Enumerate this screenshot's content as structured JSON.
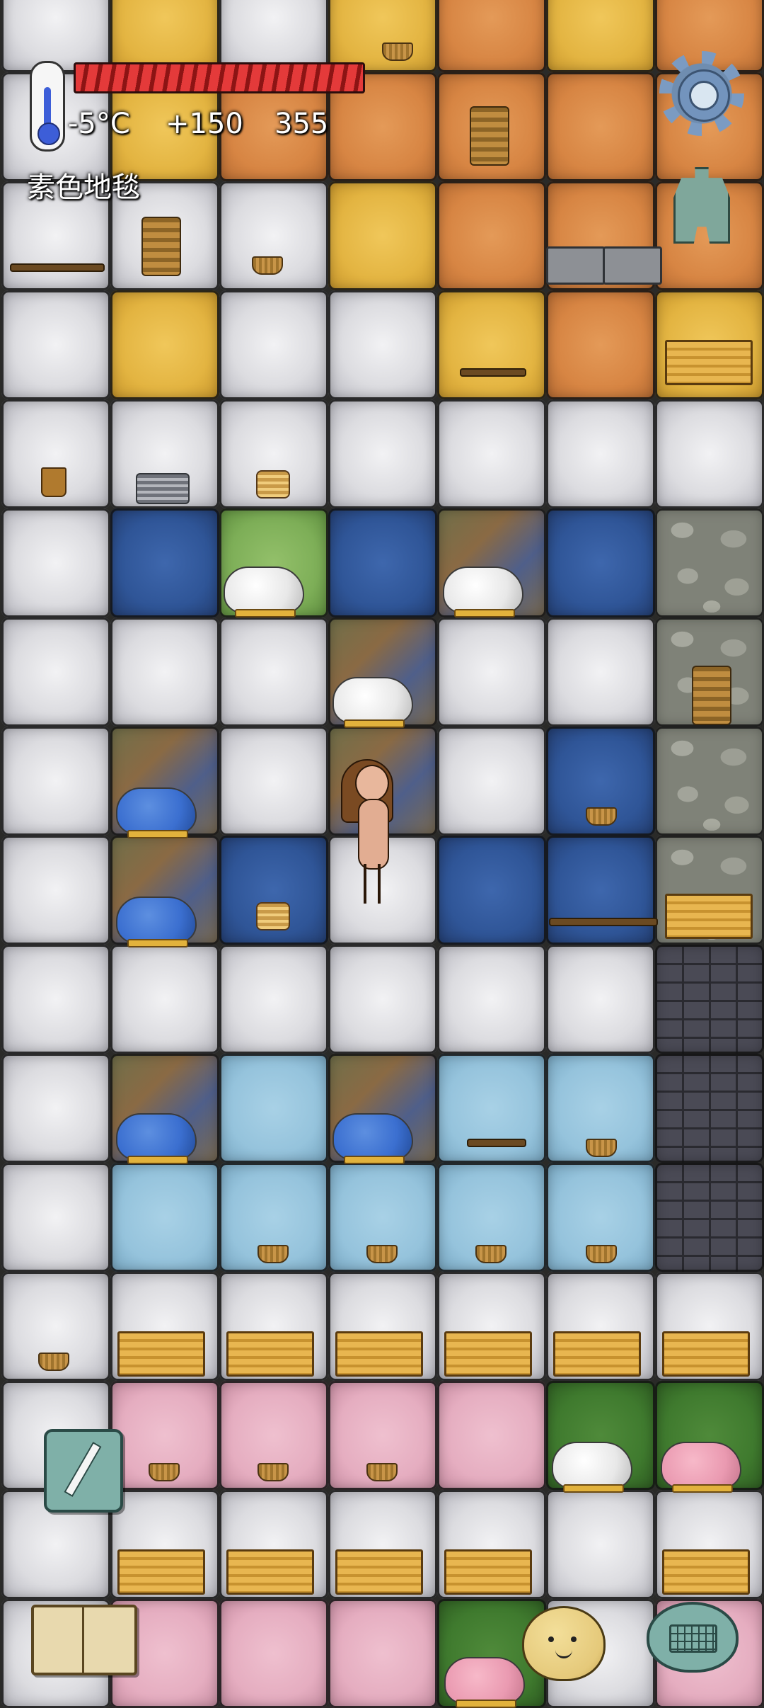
{
  "hud": {
    "temperature": "-5°C",
    "score_delta": "+150",
    "score_total": "355",
    "held_item": "素色地毯",
    "food_level": 1.0
  },
  "icons": {
    "temperature": "thermometer-icon",
    "settings": "gear-icon",
    "currency": "spade-coin-icon",
    "note": "pencil-note-icon",
    "book": "open-book-icon",
    "emote": "smiley-face-icon",
    "keyboard": "keyboard-chat-icon"
  },
  "colors": {
    "food_bar": "#e43a3a",
    "temperature_mercury": "#3d5ed8"
  },
  "map": {
    "rows": [
      [
        "stone",
        "yellow",
        "stone",
        "yellow",
        "orange",
        "yellow",
        "orange"
      ],
      [
        "stone",
        "yellow",
        "orange",
        "orange",
        "orange",
        "orange",
        "orange"
      ],
      [
        "stone",
        "stone",
        "stone",
        "yellow",
        "orange",
        "orange",
        "orange"
      ],
      [
        "stone",
        "yellow",
        "stone",
        "stone",
        "yellow",
        "orange",
        "yellow"
      ],
      [
        "stone",
        "stone",
        "stone",
        "stone",
        "stone",
        "stone",
        "stone"
      ],
      [
        "stone",
        "blue",
        "grass",
        "blue",
        "mud",
        "blue",
        "cobble"
      ],
      [
        "stone",
        "stone",
        "stone",
        "mud",
        "stone",
        "stone",
        "cobble"
      ],
      [
        "stone",
        "mud",
        "stone",
        "mud",
        "stone",
        "blue",
        "cobble"
      ],
      [
        "stone",
        "mud",
        "blue",
        "stone",
        "blue",
        "blue",
        "cobble"
      ],
      [
        "stone",
        "stone",
        "stone",
        "stone",
        "stone",
        "stone",
        "brick"
      ],
      [
        "stone",
        "mud",
        "lightblue",
        "mud",
        "lightblue",
        "lightblue",
        "brick"
      ],
      [
        "stone",
        "lightblue",
        "lightblue",
        "lightblue",
        "lightblue",
        "lightblue",
        "brick"
      ],
      [
        "stone",
        "stone",
        "stone",
        "stone",
        "stone",
        "stone",
        "stone"
      ],
      [
        "stone",
        "pink",
        "pink",
        "pink",
        "pink",
        "green",
        "green"
      ],
      [
        "stone",
        "stone",
        "stone",
        "stone",
        "stone",
        "stone",
        "stone"
      ],
      [
        "stone",
        "pink",
        "pink",
        "pink",
        "green",
        "stone",
        "pink"
      ]
    ]
  }
}
